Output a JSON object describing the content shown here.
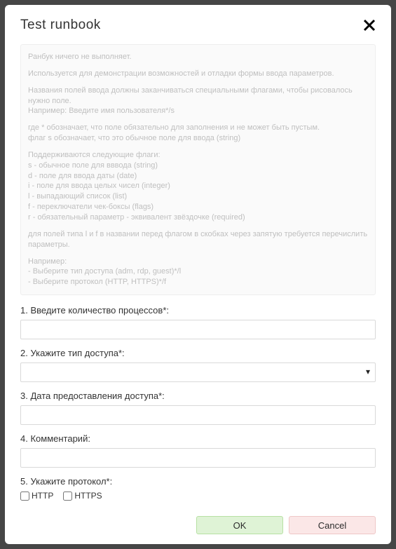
{
  "dialog": {
    "title": "Test runbook",
    "close_label": "Close"
  },
  "description": {
    "paragraphs": [
      "Ранбук ничего не выполняет.",
      "Используется для демонстрации возможностей и отладки формы ввода параметров.",
      "Названия полей ввода должны заканчиваться специальными флагами, чтобы рисовалось нужно поле.\nНапример: Введите имя пользователя*/s",
      "где * обозначает, что поле обязательно для заполнения и не может быть пустым.\nфлаг s обозначает, что это обычное поле для ввода (string)",
      "Поддерживаются следующие флаги:\ns - обычное поле для вввода (string)\nd - поле для ввода даты (date)\ni - поле для ввода целых чисел (integer)\nl - выпадающий список (list)\nf - переключатели чек-боксы (flags)\nr - обязательный параметр - эквивалент звёздочке (required)",
      "для полей типа l и f в названии перед флагом в скобках через запятую требуется перечислить параметры.",
      "Например:\n- Выберите тип доступа (adm, rdp, guest)*/l\n- Выберите протокол (HTTP, HTTPS)*/f"
    ]
  },
  "form": {
    "fields": [
      {
        "label": "1. Введите количество процессов*:",
        "type": "text",
        "value": ""
      },
      {
        "label": "2. Укажите тип доступа*:",
        "type": "select",
        "value": "",
        "options": [
          ""
        ]
      },
      {
        "label": "3. Дата предоставления доступа*:",
        "type": "text",
        "value": ""
      },
      {
        "label": "4. Комментарий:",
        "type": "text",
        "value": ""
      },
      {
        "label": "5. Укажите протокол*:",
        "type": "flags",
        "options": [
          "HTTP",
          "HTTPS"
        ]
      }
    ]
  },
  "footer": {
    "ok_label": "OK",
    "cancel_label": "Cancel"
  }
}
